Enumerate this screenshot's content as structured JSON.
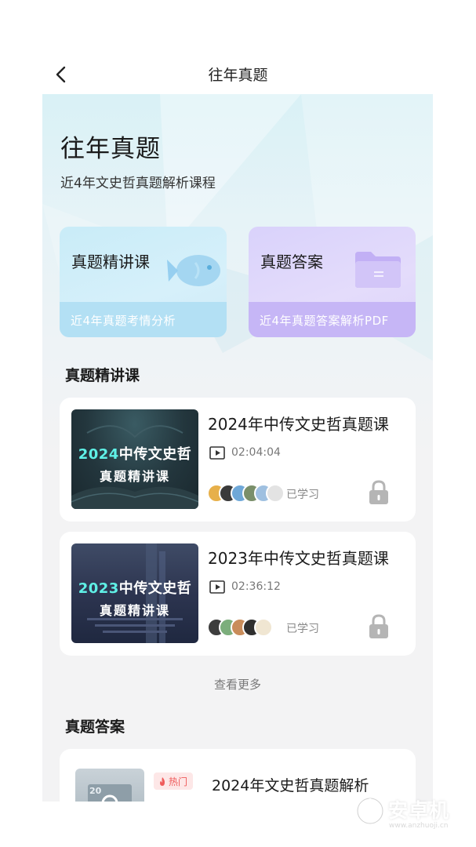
{
  "nav": {
    "title": "往年真题"
  },
  "hero": {
    "title": "往年真题",
    "subtitle": "近4年文史哲真题解析课程",
    "cards": [
      {
        "title": "真题精讲课",
        "subtitle": "近4年真题考情分析",
        "icon": "fish-icon"
      },
      {
        "title": "真题答案",
        "subtitle": "近4年真题答案解析PDF",
        "icon": "folder-icon"
      }
    ]
  },
  "sections": {
    "lectures": "真题精讲课",
    "answers": "真题答案"
  },
  "courses": [
    {
      "thumb_year": "2024",
      "thumb_line1_rest": "中传文史哲",
      "thumb_line2": "真题精讲课",
      "title": "2024年中传文史哲真题课",
      "duration": "02:04:04",
      "learned": "已学习"
    },
    {
      "thumb_year": "2023",
      "thumb_line1_rest": "中传文史哲",
      "thumb_line2": "真题精讲课",
      "title": "2023年中传文史哲真题课",
      "duration": "02:36:12",
      "learned": "已学习"
    }
  ],
  "more": "查看更多",
  "answers": [
    {
      "badge": "热门",
      "title": "2024年文史哲真题解析",
      "thumb_text": "20"
    }
  ],
  "watermark": {
    "text": "安卓机",
    "url": "www.anzhuoji.cn"
  }
}
